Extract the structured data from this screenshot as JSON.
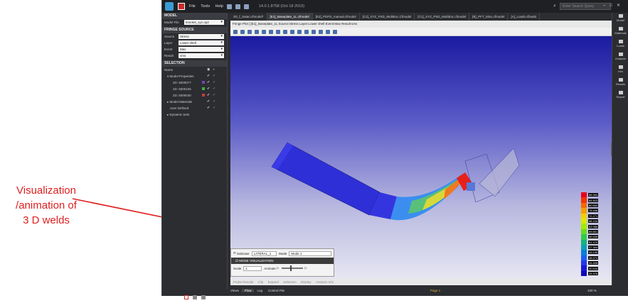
{
  "annotation": {
    "lines": [
      "Visualization",
      "/animation of",
      "3 D welds"
    ]
  },
  "app": {
    "title": "14.0.1.8758 (Oct 18 2019)",
    "menu": [
      "File",
      "Tools",
      "Help"
    ],
    "search_placeholder": "Enter Search Query"
  },
  "model_section": {
    "header": "MODEL",
    "label": "Model File",
    "value": "bracket_xyz.op2"
  },
  "fringe_source": {
    "header": "FRINGE SOURCE",
    "rows": [
      {
        "label": "Source",
        "value": "Stress"
      },
      {
        "label": "Layer",
        "value": "Lower shell"
      },
      {
        "label": "Event",
        "value": "Max"
      },
      {
        "label": "Result",
        "value": "vms"
      }
    ]
  },
  "selection": {
    "header": "SELECTION",
    "name_col": "Name",
    "tree": [
      "Model Properties",
      "2D: 5000077",
      "2D: 5000105",
      "2D: 5000030",
      "Model Materials",
      "User Defined",
      "Dynamic Sets"
    ],
    "colors": [
      "#7b3fb5",
      "#3fae45",
      "#c93a3a"
    ]
  },
  "tabs": [
    "3D_f_Satan.cfmodel*",
    "[E1]_Baseplate_1L.cfmodel",
    "[E2]_PDFD_manual.cfmodel",
    "[C2]_XYZ_PSD_MultiExc.Cfmodel",
    "[C1]_XYZ_PSD_MultiExc.cfmodel",
    "[B]_PFT_Mixx.cfmodel",
    "[A]_Loads.cfloads"
  ],
  "fringe_title": "Fringe Plot | [E1]_Baseplate_1L Source:Stress Layer:Lower shell Event:Max Result:vms",
  "legend": {
    "values": [
      "88.963",
      "84.823",
      "80.664",
      "76.446",
      "72.271",
      "68.104",
      "63.966",
      "59.801",
      "55.635",
      "51.470",
      "47.304",
      "43.139",
      "38.974",
      "34.808",
      "30.643",
      "26.478"
    ],
    "colors": [
      "#e8001a",
      "#f23400",
      "#f56a00",
      "#f79f00",
      "#f3d000",
      "#d7ea00",
      "#a4ea00",
      "#6adc1c",
      "#33c94a",
      "#17b47c",
      "#0ca0b0",
      "#0a7fd8",
      "#1a5ff0",
      "#2438e8",
      "#1a18d0",
      "#1008b8"
    ]
  },
  "mode_panel": {
    "subcase_label": "Subcase",
    "subcase_value": "LATERAL_1",
    "mode_label": "Mode",
    "mode_value": "Mode 1",
    "bar_label": "MODE VISUALIZATION",
    "scale_label": "Scale",
    "scale_value": "1",
    "animate_label": "Animate"
  },
  "view_tabs": [
    "Probe Results",
    "Clip",
    "Expand",
    "Selection",
    "Display",
    "Analysis Info"
  ],
  "status": {
    "items": [
      "Views",
      "Flow",
      "Log",
      "Control File"
    ],
    "page": "Page 1",
    "zoom": "100 %"
  },
  "right_tools": [
    "Model",
    "Materials",
    "Loads",
    "Analysis",
    "Info",
    "Results",
    "Report"
  ]
}
